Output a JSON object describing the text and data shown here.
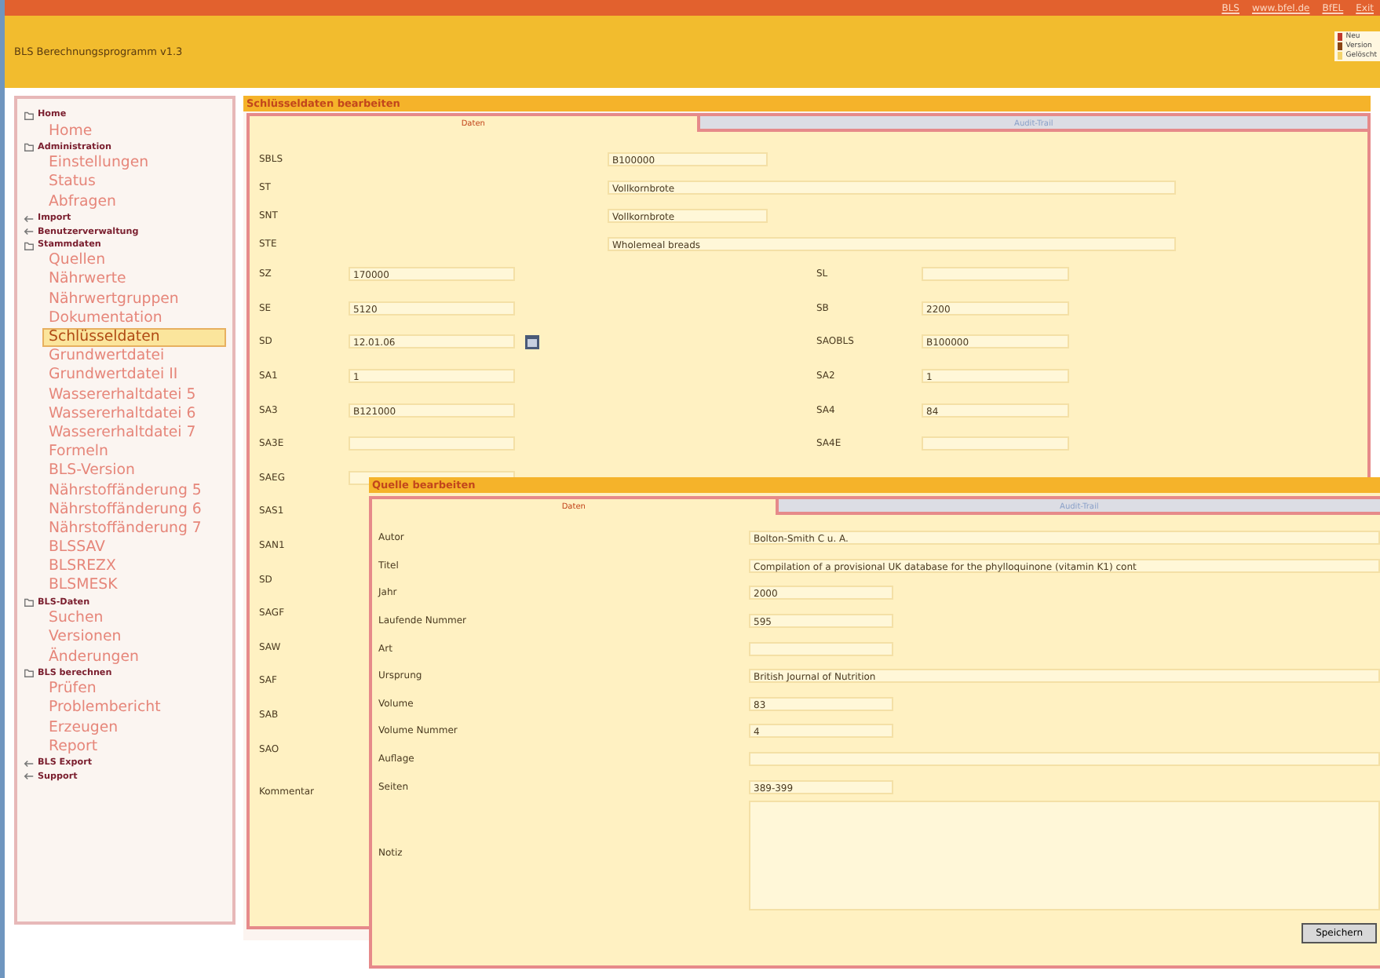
{
  "header": {
    "links": [
      "BLS",
      "www.bfel.de",
      "BfEL",
      "Exit"
    ],
    "title": "BLS Berechnungsprogramm v1.3",
    "legend": [
      {
        "label": "Neu",
        "color": "#c0392b"
      },
      {
        "label": "Version",
        "color": "#8b4513"
      },
      {
        "label": "Gelöscht",
        "color": "#f3d36b"
      }
    ]
  },
  "sidebar": [
    {
      "label": "Home",
      "expanded": true,
      "children": [
        {
          "label": "Home",
          "selected": false
        }
      ]
    },
    {
      "label": "Administration",
      "expanded": true,
      "children": [
        {
          "label": "Einstellungen",
          "selected": false
        },
        {
          "label": "Status",
          "selected": false
        },
        {
          "label": "Abfragen",
          "selected": false
        }
      ]
    },
    {
      "label": "Import",
      "expanded": false
    },
    {
      "label": "Benutzerverwaltung",
      "expanded": false
    },
    {
      "label": "Stammdaten",
      "expanded": true,
      "children": [
        {
          "label": "Quellen",
          "selected": false
        },
        {
          "label": "Nährwerte",
          "selected": false
        },
        {
          "label": "Nährwertgruppen",
          "selected": false
        },
        {
          "label": "Dokumentation",
          "selected": false
        },
        {
          "label": "Schlüsseldaten",
          "selected": true
        },
        {
          "label": "Grundwertdatei",
          "selected": false
        },
        {
          "label": "Grundwertdatei II",
          "selected": false
        },
        {
          "label": "Wassererhaltdatei 5",
          "selected": false
        },
        {
          "label": "Wassererhaltdatei 6",
          "selected": false
        },
        {
          "label": "Wassererhaltdatei 7",
          "selected": false
        },
        {
          "label": "Formeln",
          "selected": false
        },
        {
          "label": "BLS-Version",
          "selected": false
        },
        {
          "label": "Nährstoffänderung 5",
          "selected": false
        },
        {
          "label": "Nährstoffänderung 6",
          "selected": false
        },
        {
          "label": "Nährstoffänderung 7",
          "selected": false
        },
        {
          "label": "BLSSAV",
          "selected": false
        },
        {
          "label": "BLSREZX",
          "selected": false
        },
        {
          "label": "BLSMESK",
          "selected": false
        }
      ]
    },
    {
      "label": "BLS-Daten",
      "expanded": true,
      "children": [
        {
          "label": "Suchen",
          "selected": false
        },
        {
          "label": "Versionen",
          "selected": false
        },
        {
          "label": "Änderungen",
          "selected": false
        }
      ]
    },
    {
      "label": "BLS berechnen",
      "expanded": true,
      "children": [
        {
          "label": "Prüfen",
          "selected": false
        },
        {
          "label": "Problembericht",
          "selected": false
        },
        {
          "label": "Erzeugen",
          "selected": false
        },
        {
          "label": "Report",
          "selected": false
        }
      ]
    },
    {
      "label": "BLS Export",
      "expanded": false
    },
    {
      "label": "Support",
      "expanded": false
    }
  ],
  "main": {
    "title": "Schlüsseldaten bearbeiten",
    "tabs": [
      {
        "label": "Daten",
        "selected": true
      },
      {
        "label": "Audit-Trail",
        "selected": false
      }
    ],
    "top_fields": [
      {
        "label": "SBLS",
        "value": "B100000",
        "kind": "short"
      },
      {
        "label": "ST",
        "value": "Vollkornbrote",
        "kind": "long"
      },
      {
        "label": "SNT",
        "value": "Vollkornbrote",
        "kind": "short"
      },
      {
        "label": "STE",
        "value": "Wholemeal breads",
        "kind": "long"
      }
    ],
    "rows": [
      {
        "label": "SZ",
        "value": "170000",
        "right_label": "SL"
      },
      {
        "label": "SE",
        "value": "5120",
        "right_label": "SB",
        "right_value": "2200"
      },
      {
        "label": "SD",
        "value": "12.01.06",
        "calendar": true,
        "right_label": "SAOBLS",
        "right_value": "B100000"
      },
      {
        "label": "SA1",
        "value": "1",
        "right_label": "SA2",
        "right_value": "1"
      },
      {
        "label": "SA3",
        "value": "B121000",
        "right_label": "SA4",
        "right_value": "84"
      },
      {
        "label": "SA3E",
        "right_label": "SA4E"
      },
      {
        "label": "SAEG"
      },
      {
        "label": "SAS1"
      },
      {
        "label": "SAN1"
      },
      {
        "label": "SD"
      },
      {
        "label": "SAGF"
      },
      {
        "label": "SAW"
      },
      {
        "label": "SAF"
      },
      {
        "label": "SAB"
      },
      {
        "label": "SAO"
      }
    ],
    "comment_label": "Kommentar"
  },
  "dialog": {
    "title": "Quelle bearbeiten",
    "tabs": [
      {
        "label": "Daten",
        "selected": true
      },
      {
        "label": "Audit-Trail",
        "selected": false
      }
    ],
    "fields": [
      {
        "label": "Autor",
        "value": "Bolton-Smith C u. A.",
        "kind": "long"
      },
      {
        "label": "Titel",
        "value": "Compilation of a provisional UK database for the phylloquinone (vitamin K1) cont",
        "kind": "long"
      },
      {
        "label": "Jahr",
        "value": "2000",
        "kind": "short"
      },
      {
        "label": "Laufende Nummer",
        "value": "595",
        "kind": "short"
      },
      {
        "label": "Art",
        "kind": "short"
      },
      {
        "label": "Ursprung",
        "value": "British Journal of Nutrition",
        "kind": "long"
      },
      {
        "label": "Volume",
        "value": "83",
        "kind": "short"
      },
      {
        "label": "Volume Nummer",
        "value": "4",
        "kind": "short"
      },
      {
        "label": "Auflage",
        "kind": "long"
      },
      {
        "label": "Seiten",
        "value": "389-399",
        "kind": "short"
      },
      {
        "label": "Notiz",
        "kind": "area"
      }
    ],
    "button": "Speichern"
  }
}
